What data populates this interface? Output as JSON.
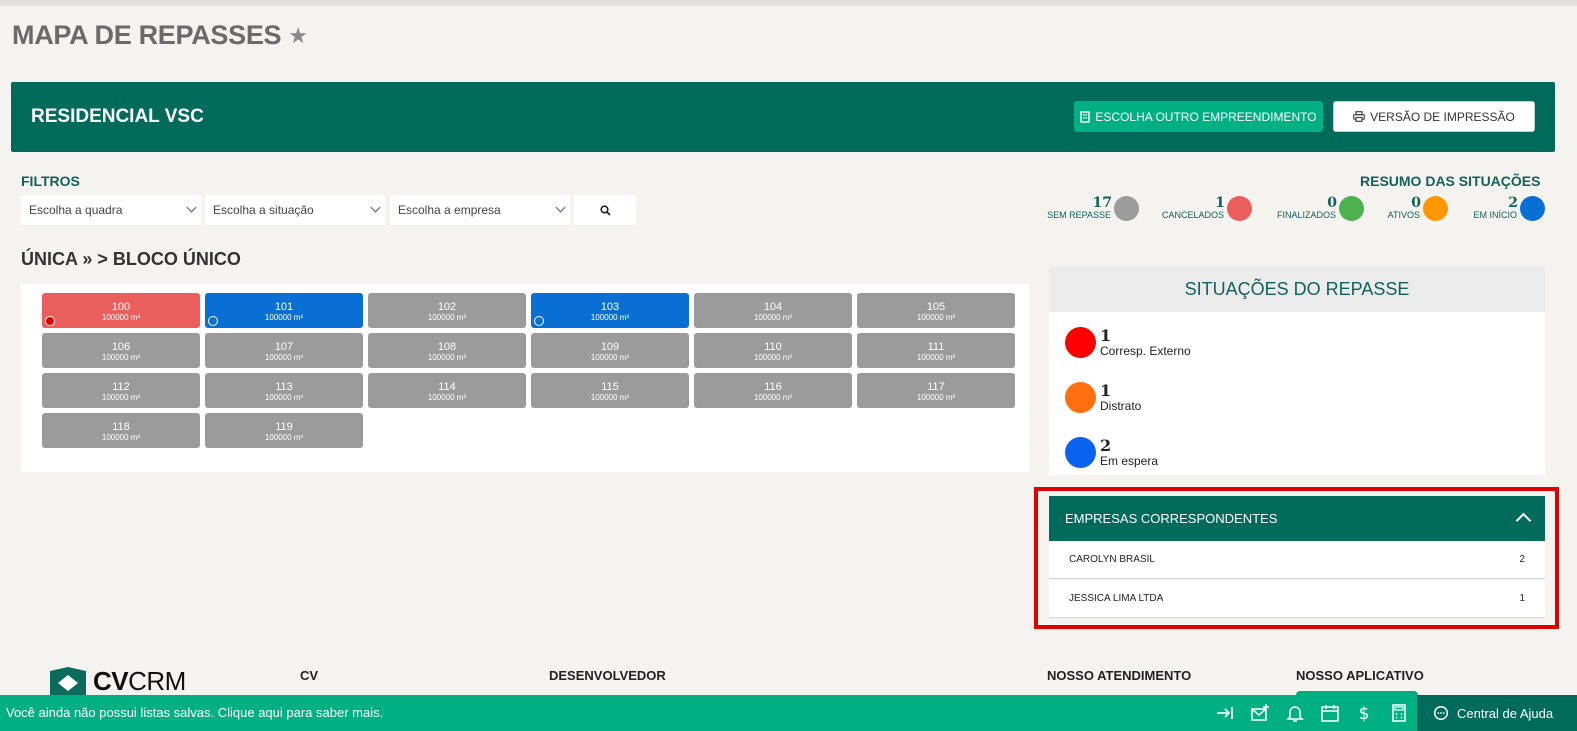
{
  "page": {
    "title": "MAPA DE REPASSES"
  },
  "banner": {
    "title": "RESIDENCIAL VSC",
    "choose_button": "ESCOLHA OUTRO EMPREENDIMENTO",
    "print_button": "VERSÃO DE IMPRESSÃO"
  },
  "filters": {
    "label": "FILTROS",
    "quadra": "Escolha a quadra",
    "situacao": "Escolha a situação",
    "empresa": "Escolha a empresa"
  },
  "resumo": {
    "label": "RESUMO DAS SITUAÇÕES",
    "items": [
      {
        "count": "17",
        "label": "SEM REPASSE",
        "color": "#9b9b9b"
      },
      {
        "count": "1",
        "label": "CANCELADOS",
        "color": "#eb5e5e"
      },
      {
        "count": "0",
        "label": "FINALIZADOS",
        "color": "#4caf50"
      },
      {
        "count": "0",
        "label": "ATIVOS",
        "color": "#ff9800"
      },
      {
        "count": "2",
        "label": "EM INÍCIO",
        "color": "#0a6fd4"
      }
    ]
  },
  "section": {
    "title": "ÚNICA » > BLOCO ÚNICO"
  },
  "units": [
    {
      "num": "100",
      "area": "100000 m²",
      "status": "red",
      "marker": "filled"
    },
    {
      "num": "101",
      "area": "100000 m²",
      "status": "blue",
      "marker": "ring"
    },
    {
      "num": "102",
      "area": "100000 m²",
      "status": "grey",
      "marker": ""
    },
    {
      "num": "103",
      "area": "100000 m²",
      "status": "blue",
      "marker": "ring"
    },
    {
      "num": "104",
      "area": "100000 m²",
      "status": "grey",
      "marker": ""
    },
    {
      "num": "105",
      "area": "100000 m²",
      "status": "grey",
      "marker": ""
    },
    {
      "num": "106",
      "area": "100000 m²",
      "status": "grey",
      "marker": ""
    },
    {
      "num": "107",
      "area": "100000 m²",
      "status": "grey",
      "marker": ""
    },
    {
      "num": "108",
      "area": "100000 m²",
      "status": "grey",
      "marker": ""
    },
    {
      "num": "109",
      "area": "100000 m²",
      "status": "grey",
      "marker": ""
    },
    {
      "num": "110",
      "area": "100000 m²",
      "status": "grey",
      "marker": ""
    },
    {
      "num": "111",
      "area": "100000 m²",
      "status": "grey",
      "marker": ""
    },
    {
      "num": "112",
      "area": "100000 m²",
      "status": "grey",
      "marker": ""
    },
    {
      "num": "113",
      "area": "100000 m²",
      "status": "grey",
      "marker": ""
    },
    {
      "num": "114",
      "area": "100000 m²",
      "status": "grey",
      "marker": ""
    },
    {
      "num": "115",
      "area": "100000 m²",
      "status": "grey",
      "marker": ""
    },
    {
      "num": "116",
      "area": "100000 m²",
      "status": "grey",
      "marker": ""
    },
    {
      "num": "117",
      "area": "100000 m²",
      "status": "grey",
      "marker": ""
    },
    {
      "num": "118",
      "area": "100000 m²",
      "status": "grey",
      "marker": ""
    },
    {
      "num": "119",
      "area": "100000 m²",
      "status": "grey",
      "marker": ""
    }
  ],
  "situacoes": {
    "title": "SITUAÇÕES DO REPASSE",
    "items": [
      {
        "count": "1",
        "label": "Corresp. Externo",
        "color": "#ff0000"
      },
      {
        "count": "1",
        "label": "Distrato",
        "color": "#ff6f0f"
      },
      {
        "count": "2",
        "label": "Em espera",
        "color": "#0a63f0"
      }
    ]
  },
  "empresas": {
    "title": "EMPRESAS CORRESPONDENTES",
    "rows": [
      {
        "name": "CAROLYN BRASIL",
        "count": "2"
      },
      {
        "name": "JESSICA LIMA LTDA",
        "count": "1"
      }
    ]
  },
  "footer": {
    "logo_bold": "CV",
    "logo_light": "CRM",
    "col1": "CV",
    "col2": "DESENVOLVEDOR",
    "col3": "NOSSO ATENDIMENTO",
    "col4": "NOSSO APLICATIVO"
  },
  "bottom_bar": {
    "message": "Você ainda não possui listas salvas. Clique aqui para saber mais.",
    "help": "Central de Ajuda"
  }
}
